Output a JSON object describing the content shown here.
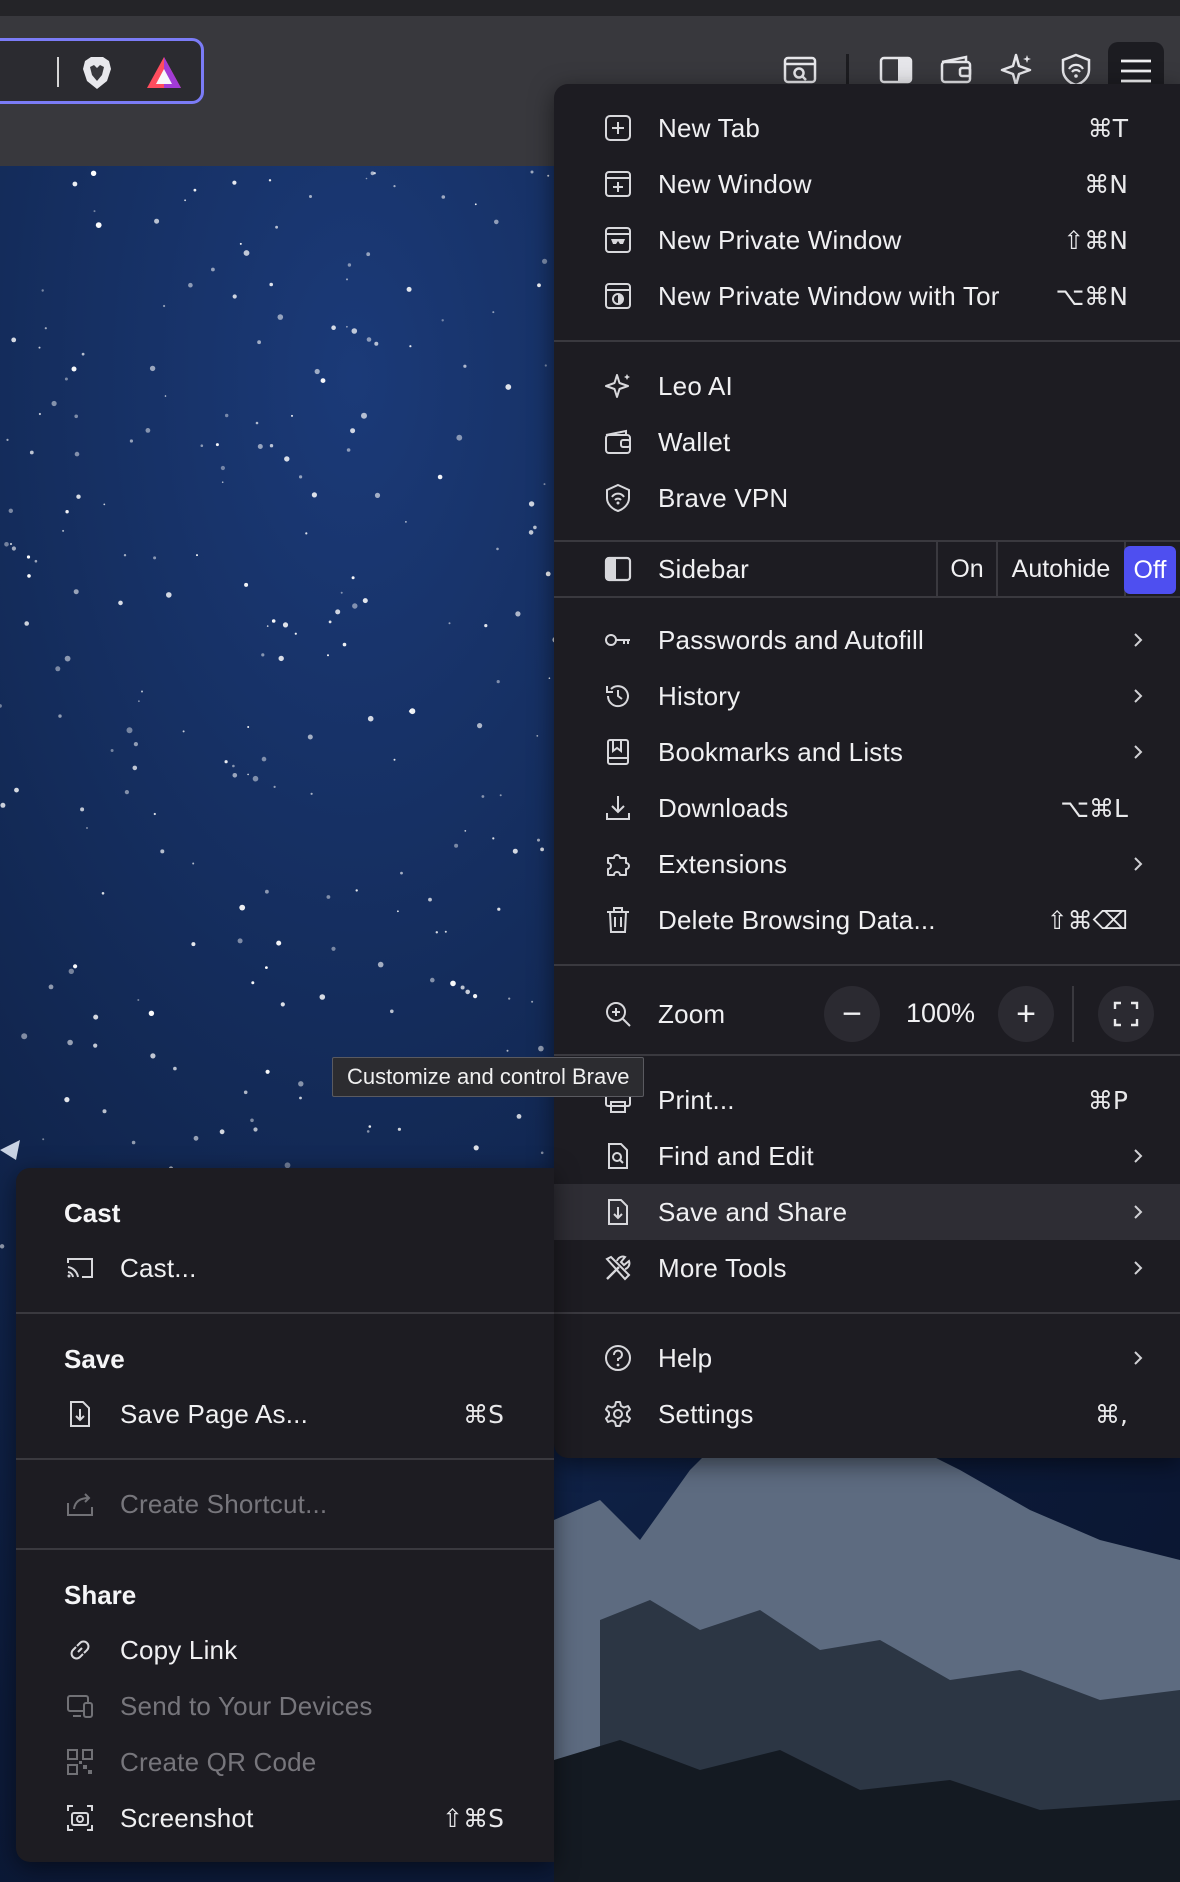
{
  "main_menu": {
    "new_tab": {
      "label": "New Tab",
      "shortcut": "⌘T"
    },
    "new_window": {
      "label": "New Window",
      "shortcut": "⌘N"
    },
    "new_private_window": {
      "label": "New Private Window",
      "shortcut": "⇧⌘N"
    },
    "new_private_tor": {
      "label": "New Private Window with Tor",
      "shortcut": "⌥⌘N"
    },
    "leo_ai": {
      "label": "Leo AI"
    },
    "wallet": {
      "label": "Wallet"
    },
    "brave_vpn": {
      "label": "Brave VPN"
    },
    "sidebar": {
      "label": "Sidebar",
      "options": [
        "On",
        "Autohide",
        "Off"
      ],
      "selected": "Off"
    },
    "passwords": {
      "label": "Passwords and Autofill"
    },
    "history": {
      "label": "History"
    },
    "bookmarks": {
      "label": "Bookmarks and Lists"
    },
    "downloads": {
      "label": "Downloads",
      "shortcut": "⌥⌘L"
    },
    "extensions": {
      "label": "Extensions"
    },
    "delete_data": {
      "label": "Delete Browsing Data...",
      "shortcut": "⇧⌘⌫"
    },
    "zoom": {
      "label": "Zoom",
      "value": "100%",
      "minus": "−",
      "plus": "+"
    },
    "print": {
      "label": "Print...",
      "shortcut": "⌘P"
    },
    "find_edit": {
      "label": "Find and Edit"
    },
    "save_share": {
      "label": "Save and Share"
    },
    "more_tools": {
      "label": "More Tools"
    },
    "help": {
      "label": "Help"
    },
    "settings": {
      "label": "Settings",
      "shortcut": "⌘,"
    }
  },
  "tooltip": {
    "text": "Customize and control Brave"
  },
  "submenu": {
    "cast_heading": "Cast",
    "cast": {
      "label": "Cast..."
    },
    "save_heading": "Save",
    "save_page": {
      "label": "Save Page As...",
      "shortcut": "⌘S"
    },
    "create_shortcut": {
      "label": "Create Shortcut..."
    },
    "share_heading": "Share",
    "copy_link": {
      "label": "Copy Link"
    },
    "send_devices": {
      "label": "Send to Your Devices"
    },
    "qr_code": {
      "label": "Create QR Code"
    },
    "screenshot": {
      "label": "Screenshot",
      "shortcut": "⇧⌘S"
    }
  },
  "colors": {
    "menu_bg": "#1d1c22",
    "accent": "#4e4ff0",
    "urlbar_focus": "#7b7cf7",
    "toolbar_bg": "#38383d"
  }
}
